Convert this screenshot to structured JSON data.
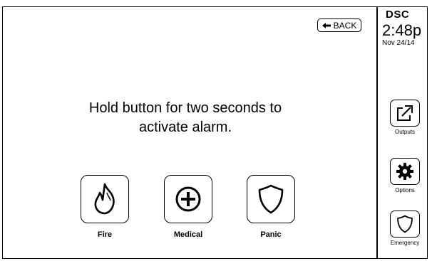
{
  "screen": {
    "back_label": "BACK",
    "instruction_line1": "Hold button for two seconds to",
    "instruction_line2": "activate alarm."
  },
  "actions": [
    {
      "label": "Fire",
      "icon": "fire-icon"
    },
    {
      "label": "Medical",
      "icon": "medical-plus-icon"
    },
    {
      "label": "Panic",
      "icon": "shield-icon"
    }
  ],
  "status": {
    "brand": "DSC",
    "time": "2:48p",
    "date": "Nov 24/14"
  },
  "sidebar": [
    {
      "label": "Outputs",
      "icon": "outputs-icon"
    },
    {
      "label": "Options",
      "icon": "gear-icon"
    },
    {
      "label": "Emergency",
      "icon": "shield-icon"
    }
  ]
}
